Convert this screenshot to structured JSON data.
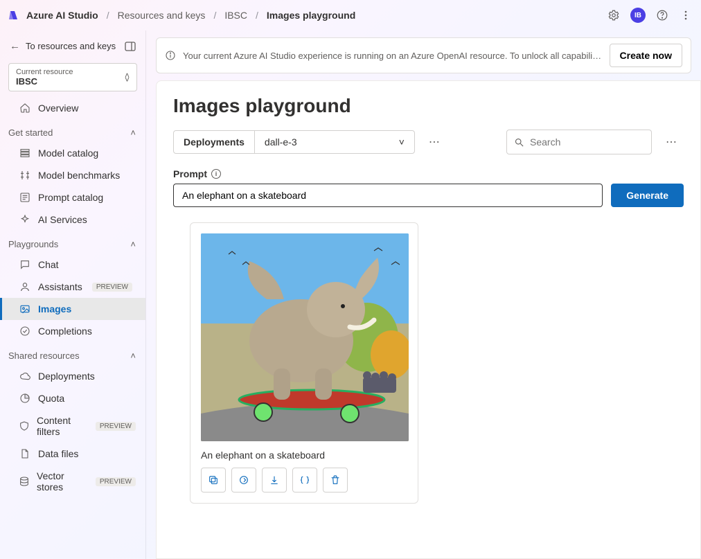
{
  "breadcrumb": {
    "root": "Azure AI Studio",
    "items": [
      "Resources and keys",
      "IBSC",
      "Images playground"
    ]
  },
  "topbar": {
    "avatar_initials": "IB"
  },
  "sidebar": {
    "back_label": "To resources and keys",
    "resource": {
      "label": "Current resource",
      "value": "IBSC"
    },
    "overview": "Overview",
    "group_get_started": "Get started",
    "items_get_started": [
      {
        "label": "Model catalog"
      },
      {
        "label": "Model benchmarks"
      },
      {
        "label": "Prompt catalog"
      },
      {
        "label": "AI Services"
      }
    ],
    "group_playgrounds": "Playgrounds",
    "items_playgrounds": [
      {
        "label": "Chat"
      },
      {
        "label": "Assistants",
        "preview": "PREVIEW"
      },
      {
        "label": "Images",
        "active": true
      },
      {
        "label": "Completions"
      }
    ],
    "group_shared": "Shared resources",
    "items_shared": [
      {
        "label": "Deployments"
      },
      {
        "label": "Quota"
      },
      {
        "label": "Content filters",
        "preview": "PREVIEW"
      },
      {
        "label": "Data files"
      },
      {
        "label": "Vector stores",
        "preview": "PREVIEW"
      }
    ]
  },
  "banner": {
    "text": "Your current Azure AI Studio experience is running on an Azure OpenAI resource. To unlock all capabilities, create a...",
    "button": "Create now"
  },
  "page": {
    "title": "Images playground",
    "deployments_label": "Deployments",
    "deployment_value": "dall-e-3",
    "search_placeholder": "Search",
    "prompt_label": "Prompt",
    "prompt_value": "An elephant on a skateboard",
    "generate_label": "Generate",
    "result_caption": "An elephant on a skateboard"
  }
}
